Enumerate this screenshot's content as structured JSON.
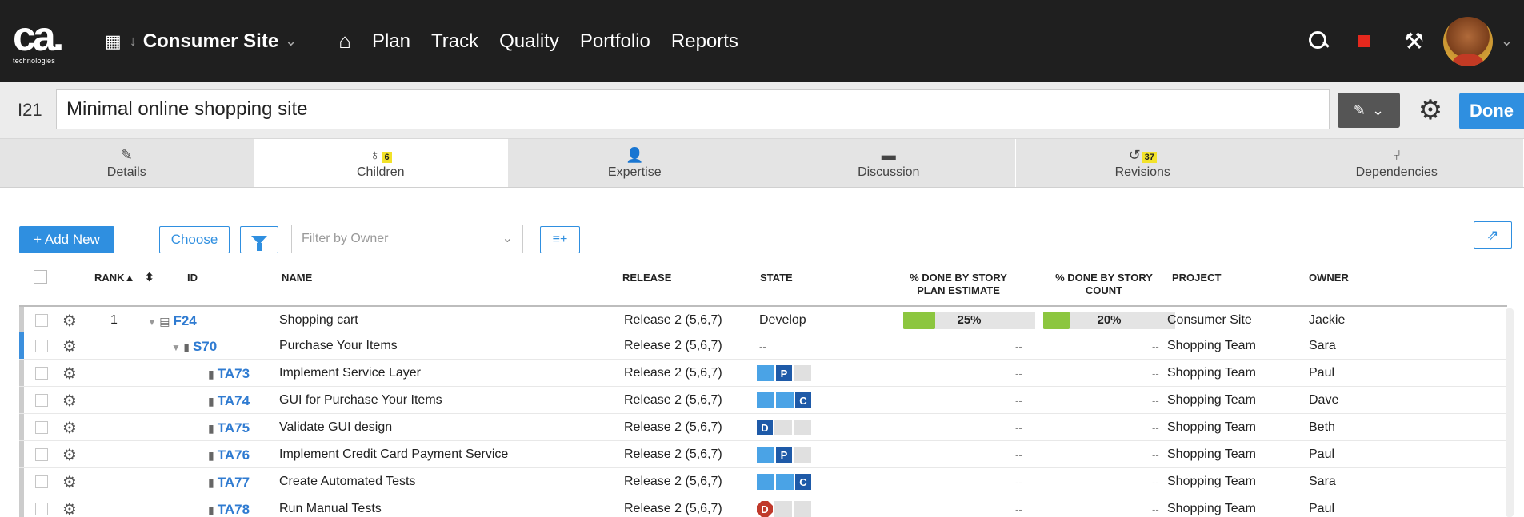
{
  "nav": {
    "logo_text": "ca.",
    "logo_sub": "technologies",
    "project_name": "Consumer Site",
    "links": [
      "Plan",
      "Track",
      "Quality",
      "Portfolio",
      "Reports"
    ]
  },
  "item": {
    "id": "I21",
    "title": "Minimal online shopping site",
    "done_label": "Done"
  },
  "tabs": [
    {
      "label": "Details",
      "icon": "pencil-icon",
      "badge": ""
    },
    {
      "label": "Children",
      "icon": "hierarchy-icon",
      "badge": "6"
    },
    {
      "label": "Expertise",
      "icon": "person-icon",
      "badge": ""
    },
    {
      "label": "Discussion",
      "icon": "speech-bubble-icon",
      "badge": ""
    },
    {
      "label": "Revisions",
      "icon": "history-icon",
      "badge": "37"
    },
    {
      "label": "Dependencies",
      "icon": "branch-icon",
      "badge": ""
    }
  ],
  "toolbar": {
    "add_new": "+ Add New",
    "choose": "Choose",
    "owner_filter_placeholder": "Filter by Owner"
  },
  "columns": {
    "rank": "RANK",
    "id": "ID",
    "name": "NAME",
    "release": "RELEASE",
    "state": "STATE",
    "pct_estimate_1": "% DONE BY STORY",
    "pct_estimate_2": "PLAN ESTIMATE",
    "pct_count_1": "% DONE BY STORY",
    "pct_count_2": "COUNT",
    "project": "PROJECT",
    "owner": "OWNER"
  },
  "rows": [
    {
      "rank": "1",
      "id": "F24",
      "name": "Shopping cart",
      "release": "Release 2 (5,6,7)",
      "state": "Develop",
      "pct_estimate": "25%",
      "pct_estimate_value": 0.25,
      "pct_count": "20%",
      "pct_count_value": 0.2,
      "project": "Consumer Site",
      "owner": "Jackie"
    },
    {
      "rank": "",
      "id": "S70",
      "name": "Purchase Your Items",
      "release": "Release 2 (5,6,7)",
      "state": "--",
      "pct_estimate": "--",
      "pct_count": "--",
      "project": "Shopping Team",
      "owner": "Sara"
    },
    {
      "rank": "",
      "id": "TA73",
      "name": "Implement Service Layer",
      "release": "Release 2 (5,6,7)",
      "state_letter": "P",
      "state_done": 1,
      "pct_estimate": "--",
      "pct_count": "--",
      "project": "Shopping Team",
      "owner": "Paul"
    },
    {
      "rank": "",
      "id": "TA74",
      "name": "GUI for Purchase Your Items",
      "release": "Release 2 (5,6,7)",
      "state_letter": "C",
      "state_done": 2,
      "pct_estimate": "--",
      "pct_count": "--",
      "project": "Shopping Team",
      "owner": "Dave"
    },
    {
      "rank": "",
      "id": "TA75",
      "name": "Validate GUI design",
      "release": "Release 2 (5,6,7)",
      "state_letter": "D",
      "state_done": 0,
      "pct_estimate": "--",
      "pct_count": "--",
      "project": "Shopping Team",
      "owner": "Beth"
    },
    {
      "rank": "",
      "id": "TA76",
      "name": "Implement Credit Card Payment Service",
      "release": "Release 2 (5,6,7)",
      "state_letter": "P",
      "state_done": 1,
      "pct_estimate": "--",
      "pct_count": "--",
      "project": "Shopping Team",
      "owner": "Paul"
    },
    {
      "rank": "",
      "id": "TA77",
      "name": "Create Automated Tests",
      "release": "Release 2 (5,6,7)",
      "state_letter": "C",
      "state_done": 2,
      "pct_estimate": "--",
      "pct_count": "--",
      "project": "Shopping Team",
      "owner": "Sara"
    },
    {
      "rank": "",
      "id": "TA78",
      "name": "Run Manual Tests",
      "release": "Release 2 (5,6,7)",
      "state_letter": "D",
      "state_done": 0,
      "state_blocked": true,
      "pct_estimate": "--",
      "pct_count": "--",
      "project": "Shopping Team",
      "owner": "Paul"
    }
  ],
  "colors": {
    "accent": "#2f8fe0",
    "progress_fill": "#8cc63f",
    "state_letter": "#1e5aa8",
    "blocked": "#c0392b",
    "badge": "#f2e22a"
  }
}
